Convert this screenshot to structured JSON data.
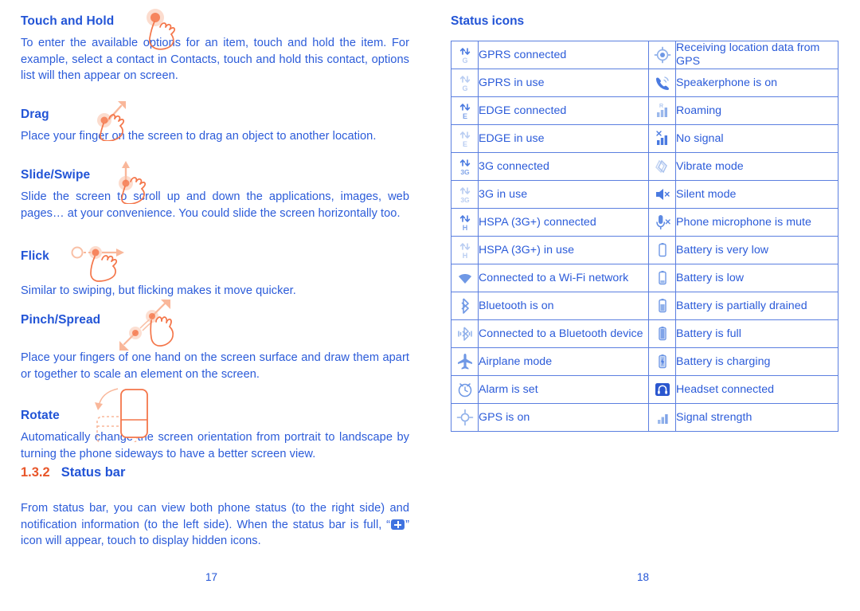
{
  "colors": {
    "text_blue": "#2b5bd9",
    "heading_blue": "#2254d6",
    "section_number_orange": "#e8562a",
    "illustration_orange": "#f4764a",
    "table_border": "#5b7fe0",
    "icon_blue": "#4a7ae0"
  },
  "left_page": {
    "page_number": "17",
    "gestures": [
      {
        "heading": "Touch and Hold",
        "illustration": "hand-touch-and-hold-icon",
        "body": "To enter the available options for an item, touch and hold the item. For example, select a contact in Contacts, touch and hold this contact, options list will then appear on screen."
      },
      {
        "heading": "Drag",
        "illustration": "hand-drag-icon",
        "body": "Place your finger on the screen to drag an object to another location."
      },
      {
        "heading": "Slide/Swipe",
        "illustration": "hand-slide-swipe-icon",
        "body": "Slide the screen to scroll up and down the applications, images, web pages… at your convenience. You could slide the screen horizontally too."
      },
      {
        "heading": "Flick",
        "illustration": "hand-flick-icon",
        "body": "Similar to swiping, but flicking makes it move quicker."
      },
      {
        "heading": "Pinch/Spread",
        "illustration": "hand-pinch-spread-icon",
        "body": "Place your fingers of one hand on the screen surface and draw them apart or together to scale an element on the screen."
      },
      {
        "heading": "Rotate",
        "illustration": "phone-rotate-icon",
        "body": "Automatically change the screen orientation from portrait to landscape by turning the phone sideways to have a better screen view."
      }
    ],
    "section": {
      "number": "1.3.2",
      "title": "Status bar",
      "body_part1": "From status bar, you can view both phone status (to the right side) and notification information (to the left side). When the status bar is full, “",
      "inline_icon": "plus-badge-icon",
      "body_part2": "” icon will appear, touch to display hidden icons."
    }
  },
  "right_page": {
    "page_number": "18",
    "title": "Status icons",
    "table": {
      "type": "table",
      "columns": [
        "icon",
        "label",
        "icon",
        "label"
      ],
      "rows": [
        {
          "left_icon": "gprs-connected-icon",
          "left_label": "GPRS connected",
          "right_icon": "gps-receiving-icon",
          "right_label": "Receiving location data from GPS"
        },
        {
          "left_icon": "gprs-in-use-icon",
          "left_label": "GPRS in use",
          "right_icon": "speakerphone-icon",
          "right_label": "Speakerphone is on"
        },
        {
          "left_icon": "edge-connected-icon",
          "left_label": "EDGE connected",
          "right_icon": "roaming-icon",
          "right_label": "Roaming"
        },
        {
          "left_icon": "edge-in-use-icon",
          "left_label": "EDGE in use",
          "right_icon": "no-signal-icon",
          "right_label": "No signal"
        },
        {
          "left_icon": "3g-connected-icon",
          "left_label": "3G connected",
          "right_icon": "vibrate-mode-icon",
          "right_label": "Vibrate mode"
        },
        {
          "left_icon": "3g-in-use-icon",
          "left_label": "3G in use",
          "right_icon": "silent-mode-icon",
          "right_label": "Silent mode"
        },
        {
          "left_icon": "hspa-connected-icon",
          "left_label": "HSPA (3G+) connected",
          "right_icon": "microphone-mute-icon",
          "right_label": "Phone microphone is mute"
        },
        {
          "left_icon": "hspa-in-use-icon",
          "left_label": "HSPA (3G+) in use",
          "right_icon": "battery-very-low-icon",
          "right_label": "Battery is very low"
        },
        {
          "left_icon": "wifi-connected-icon",
          "left_label": "Connected to a Wi-Fi network",
          "right_icon": "battery-low-icon",
          "right_label": "Battery is low"
        },
        {
          "left_icon": "bluetooth-on-icon",
          "left_label": "Bluetooth is on",
          "right_icon": "battery-partial-icon",
          "right_label": "Battery is partially drained"
        },
        {
          "left_icon": "bluetooth-connected-icon",
          "left_label": "Connected to a Bluetooth device",
          "right_icon": "battery-full-icon",
          "right_label": "Battery is full"
        },
        {
          "left_icon": "airplane-mode-icon",
          "left_label": "Airplane mode",
          "right_icon": "battery-charging-icon",
          "right_label": "Battery is charging"
        },
        {
          "left_icon": "alarm-set-icon",
          "left_label": "Alarm is set",
          "right_icon": "headset-connected-icon",
          "right_label": "Headset connected"
        },
        {
          "left_icon": "gps-on-icon",
          "left_label": "GPS is on",
          "right_icon": "signal-strength-icon",
          "right_label": "Signal strength"
        }
      ]
    }
  }
}
